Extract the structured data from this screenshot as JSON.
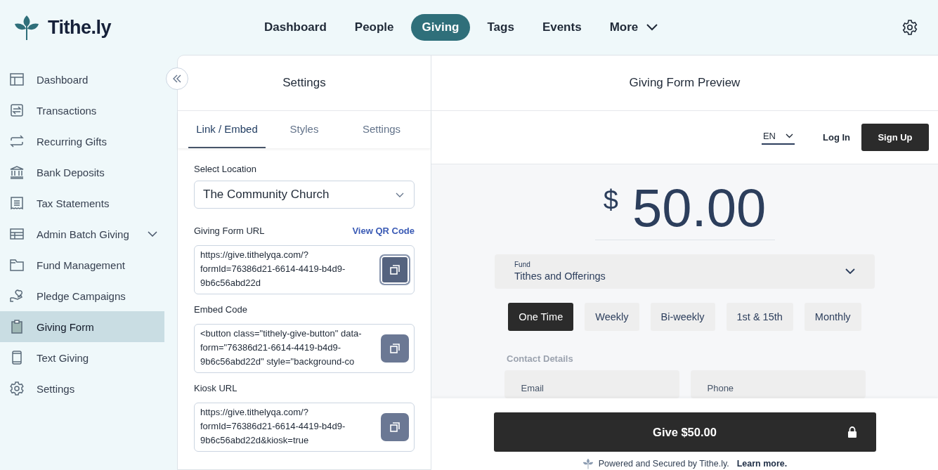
{
  "brand": {
    "name": "Tithe.ly"
  },
  "top_nav": [
    {
      "label": "Dashboard",
      "selected": false
    },
    {
      "label": "People",
      "selected": false
    },
    {
      "label": "Giving",
      "selected": true
    },
    {
      "label": "Tags",
      "selected": false
    },
    {
      "label": "Events",
      "selected": false
    },
    {
      "label": "More",
      "selected": false,
      "kind": "dropdown"
    }
  ],
  "sidebar": {
    "items": [
      {
        "label": "Dashboard",
        "selected": false,
        "expandable": false
      },
      {
        "label": "Transactions",
        "selected": false,
        "expandable": false
      },
      {
        "label": "Recurring Gifts",
        "selected": false,
        "expandable": false
      },
      {
        "label": "Bank Deposits",
        "selected": false,
        "expandable": false
      },
      {
        "label": "Tax Statements",
        "selected": false,
        "expandable": false
      },
      {
        "label": "Admin Batch Giving",
        "selected": false,
        "expandable": true
      },
      {
        "label": "Fund Management",
        "selected": false,
        "expandable": false
      },
      {
        "label": "Pledge Campaigns",
        "selected": false,
        "expandable": false
      },
      {
        "label": "Giving Form",
        "selected": true,
        "expandable": false
      },
      {
        "label": "Text Giving",
        "selected": false,
        "expandable": false
      },
      {
        "label": "Settings",
        "selected": false,
        "expandable": false
      }
    ]
  },
  "settings_panel": {
    "title": "Settings",
    "tabs": [
      {
        "label": "Link / Embed",
        "selected": true
      },
      {
        "label": "Styles",
        "selected": false
      },
      {
        "label": "Settings",
        "selected": false
      }
    ],
    "location": {
      "label": "Select Location",
      "value": "The Community Church"
    },
    "fields": [
      {
        "label": "Giving Form URL",
        "link": "View QR Code",
        "value": "https://give.tithelyqa.com/? formId=76386d21-6614-4419-b4d9-9b6c56abd22d",
        "focused": true
      },
      {
        "label": "Embed Code",
        "value": "<button class=\"tithely-give-button\" data-form=\"76386d21-6614-4419-b4d9-9b6c56abd22d\" style=\"background-co",
        "focused": false
      },
      {
        "label": "Kiosk URL",
        "value": "https://give.tithelyqa.com/? formId=76386d21-6614-4419-b4d9-9b6c56abd22d&kiosk=true",
        "focused": false
      }
    ]
  },
  "preview": {
    "title": "Giving Form Preview",
    "language": "EN",
    "login": "Log In",
    "signup": "Sign Up",
    "currency": "$",
    "amount": "50.00",
    "fund": {
      "label": "Fund",
      "value": "Tithes and Offerings"
    },
    "frequencies": [
      {
        "label": "One Time",
        "selected": true
      },
      {
        "label": "Weekly",
        "selected": false
      },
      {
        "label": "Bi-weekly",
        "selected": false
      },
      {
        "label": "1st & 15th",
        "selected": false
      },
      {
        "label": "Monthly",
        "selected": false
      }
    ],
    "contact": {
      "title": "Contact Details",
      "fields": [
        {
          "placeholder": "Email"
        },
        {
          "placeholder": "Phone"
        }
      ]
    },
    "give_button": "Give $50.00",
    "footer": {
      "text": "Powered and Secured by Tithe.ly.",
      "link": "Learn more."
    }
  }
}
